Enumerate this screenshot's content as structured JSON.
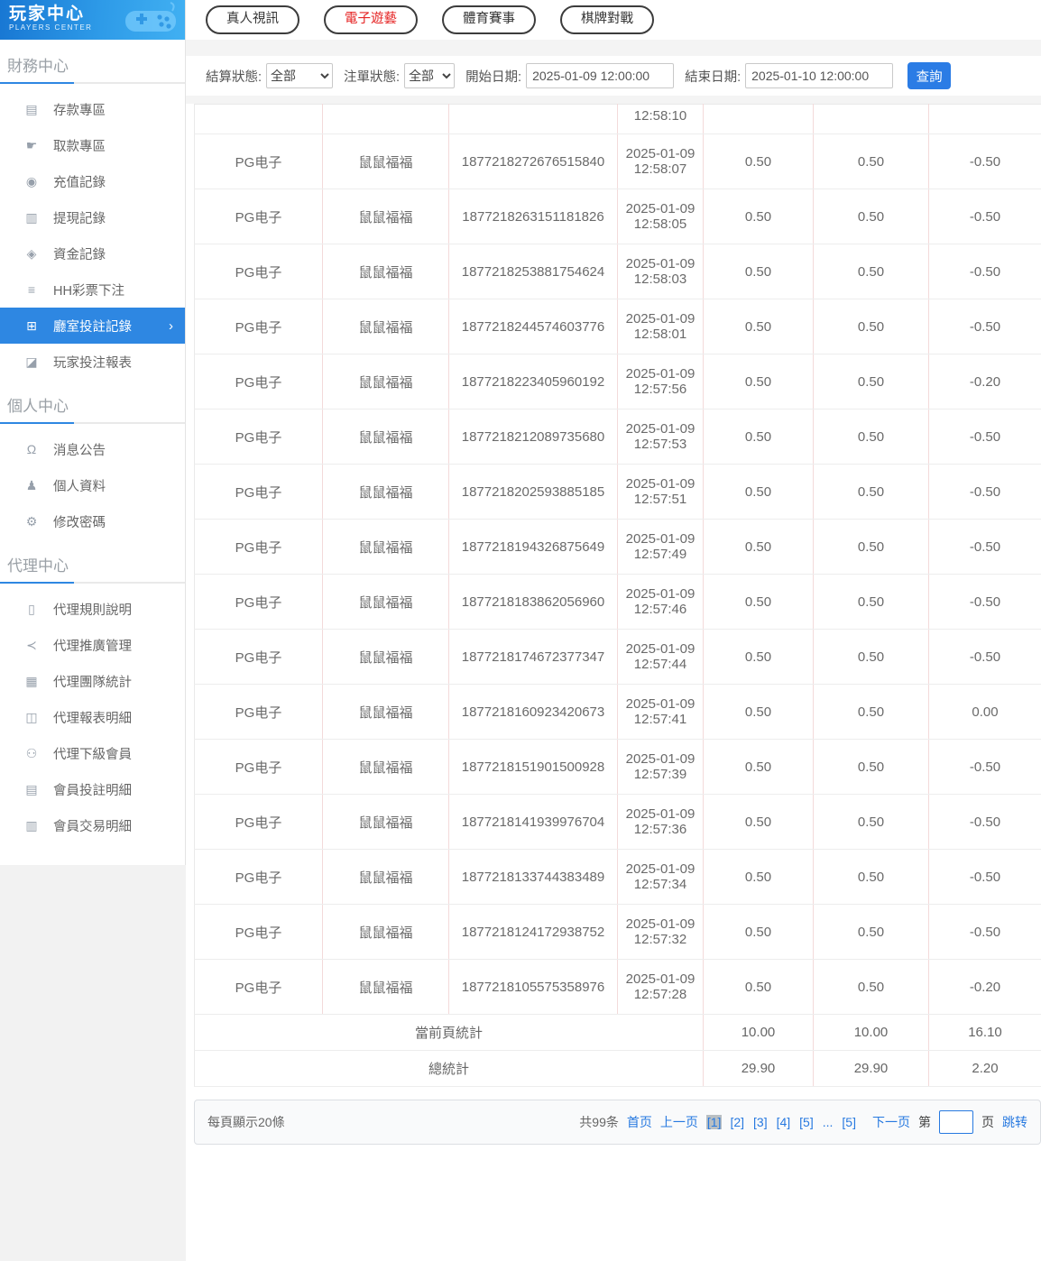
{
  "brand": {
    "title": "玩家中心",
    "subtitle": "PLAYERS CENTER"
  },
  "sidebar": {
    "chevron": "›",
    "sections": [
      {
        "title": "財務中心",
        "items": [
          {
            "label": "存款專區",
            "icon": "deposit-card",
            "glyph": "▤"
          },
          {
            "label": "取款專區",
            "icon": "withdraw-hand",
            "glyph": "☛"
          },
          {
            "label": "充值記錄",
            "icon": "recharge-record",
            "glyph": "◉"
          },
          {
            "label": "提現記錄",
            "icon": "withdrawal-record",
            "glyph": "▥"
          },
          {
            "label": "資金記錄",
            "icon": "funds-record",
            "glyph": "◈"
          },
          {
            "label": "HH彩票下注",
            "icon": "lottery-bet",
            "glyph": "≡"
          },
          {
            "label": "廳室投註記錄",
            "icon": "room-bet-record",
            "glyph": "⊞",
            "active": true
          },
          {
            "label": "玩家投注報表",
            "icon": "player-report",
            "glyph": "◪"
          }
        ]
      },
      {
        "title": "個人中心",
        "items": [
          {
            "label": "消息公告",
            "icon": "message-bell",
            "glyph": "Ω"
          },
          {
            "label": "個人資料",
            "icon": "profile-person",
            "glyph": "♟"
          },
          {
            "label": "修改密碼",
            "icon": "change-password-gear",
            "glyph": "⚙"
          }
        ]
      },
      {
        "title": "代理中心",
        "items": [
          {
            "label": "代理規則說明",
            "icon": "agent-rules-doc",
            "glyph": "▯"
          },
          {
            "label": "代理推廣管理",
            "icon": "agent-promotion-share",
            "glyph": "≺"
          },
          {
            "label": "代理團隊統計",
            "icon": "agent-team-stats",
            "glyph": "▦"
          },
          {
            "label": "代理報表明細",
            "icon": "agent-report-detail",
            "glyph": "◫"
          },
          {
            "label": "代理下級會員",
            "icon": "agent-sub-members",
            "glyph": "⚇"
          },
          {
            "label": "會員投註明細",
            "icon": "member-bet-detail",
            "glyph": "▤"
          },
          {
            "label": "會員交易明細",
            "icon": "member-transaction-detail",
            "glyph": "▥"
          }
        ]
      }
    ]
  },
  "tabs": [
    {
      "label": "真人視訊"
    },
    {
      "label": "電子遊藝",
      "active": true
    },
    {
      "label": "體育賽事"
    },
    {
      "label": "棋牌對戰"
    }
  ],
  "filters": {
    "settle_label": "結算狀態:",
    "settle_value": "全部",
    "order_label": "注單狀態:",
    "order_value": "全部",
    "start_label": "開始日期:",
    "start_value": "2025-01-09 12:00:00",
    "end_label": "結束日期:",
    "end_value": "2025-01-10 12:00:00",
    "search_label": "查詢"
  },
  "table": {
    "partial_time": "12:58:10",
    "rows": [
      {
        "provider": "PG电子",
        "game": "鼠鼠福福",
        "order": "1877218272676515840",
        "date": "2025-01-09",
        "time": "12:58:07",
        "bet": "0.50",
        "valid": "0.50",
        "winloss": "-0.50"
      },
      {
        "provider": "PG电子",
        "game": "鼠鼠福福",
        "order": "1877218263151181826",
        "date": "2025-01-09",
        "time": "12:58:05",
        "bet": "0.50",
        "valid": "0.50",
        "winloss": "-0.50"
      },
      {
        "provider": "PG电子",
        "game": "鼠鼠福福",
        "order": "1877218253881754624",
        "date": "2025-01-09",
        "time": "12:58:03",
        "bet": "0.50",
        "valid": "0.50",
        "winloss": "-0.50"
      },
      {
        "provider": "PG电子",
        "game": "鼠鼠福福",
        "order": "1877218244574603776",
        "date": "2025-01-09",
        "time": "12:58:01",
        "bet": "0.50",
        "valid": "0.50",
        "winloss": "-0.50"
      },
      {
        "provider": "PG电子",
        "game": "鼠鼠福福",
        "order": "1877218223405960192",
        "date": "2025-01-09",
        "time": "12:57:56",
        "bet": "0.50",
        "valid": "0.50",
        "winloss": "-0.20"
      },
      {
        "provider": "PG电子",
        "game": "鼠鼠福福",
        "order": "1877218212089735680",
        "date": "2025-01-09",
        "time": "12:57:53",
        "bet": "0.50",
        "valid": "0.50",
        "winloss": "-0.50"
      },
      {
        "provider": "PG电子",
        "game": "鼠鼠福福",
        "order": "1877218202593885185",
        "date": "2025-01-09",
        "time": "12:57:51",
        "bet": "0.50",
        "valid": "0.50",
        "winloss": "-0.50"
      },
      {
        "provider": "PG电子",
        "game": "鼠鼠福福",
        "order": "1877218194326875649",
        "date": "2025-01-09",
        "time": "12:57:49",
        "bet": "0.50",
        "valid": "0.50",
        "winloss": "-0.50"
      },
      {
        "provider": "PG电子",
        "game": "鼠鼠福福",
        "order": "1877218183862056960",
        "date": "2025-01-09",
        "time": "12:57:46",
        "bet": "0.50",
        "valid": "0.50",
        "winloss": "-0.50"
      },
      {
        "provider": "PG电子",
        "game": "鼠鼠福福",
        "order": "1877218174672377347",
        "date": "2025-01-09",
        "time": "12:57:44",
        "bet": "0.50",
        "valid": "0.50",
        "winloss": "-0.50"
      },
      {
        "provider": "PG电子",
        "game": "鼠鼠福福",
        "order": "1877218160923420673",
        "date": "2025-01-09",
        "time": "12:57:41",
        "bet": "0.50",
        "valid": "0.50",
        "winloss": "0.00"
      },
      {
        "provider": "PG电子",
        "game": "鼠鼠福福",
        "order": "1877218151901500928",
        "date": "2025-01-09",
        "time": "12:57:39",
        "bet": "0.50",
        "valid": "0.50",
        "winloss": "-0.50"
      },
      {
        "provider": "PG电子",
        "game": "鼠鼠福福",
        "order": "1877218141939976704",
        "date": "2025-01-09",
        "time": "12:57:36",
        "bet": "0.50",
        "valid": "0.50",
        "winloss": "-0.50"
      },
      {
        "provider": "PG电子",
        "game": "鼠鼠福福",
        "order": "1877218133744383489",
        "date": "2025-01-09",
        "time": "12:57:34",
        "bet": "0.50",
        "valid": "0.50",
        "winloss": "-0.50"
      },
      {
        "provider": "PG电子",
        "game": "鼠鼠福福",
        "order": "1877218124172938752",
        "date": "2025-01-09",
        "time": "12:57:32",
        "bet": "0.50",
        "valid": "0.50",
        "winloss": "-0.50"
      },
      {
        "provider": "PG电子",
        "game": "鼠鼠福福",
        "order": "1877218105575358976",
        "date": "2025-01-09",
        "time": "12:57:28",
        "bet": "0.50",
        "valid": "0.50",
        "winloss": "-0.20"
      }
    ],
    "summary": [
      {
        "label": "當前頁統計",
        "bet": "10.00",
        "valid": "10.00",
        "winloss": "16.10"
      },
      {
        "label": "總統計",
        "bet": "29.90",
        "valid": "29.90",
        "winloss": "2.20"
      }
    ]
  },
  "pagination": {
    "per_page": "每頁顯示20條",
    "total": "共99条",
    "first": "首页",
    "prev": "上一页",
    "pages": [
      {
        "label": "[1]",
        "current": true
      },
      {
        "label": "[2]"
      },
      {
        "label": "[3]"
      },
      {
        "label": "[4]"
      },
      {
        "label": "[5]"
      },
      {
        "label": "..."
      },
      {
        "label": "[5]"
      }
    ],
    "next": "下一页",
    "jump_prefix": "第",
    "jump_suffix": "页",
    "jump_action": "跳转",
    "jump_value": ""
  },
  "colors": {
    "accent_blue": "#2e87e2",
    "link_blue": "#2779e0",
    "active_red": "#e52222"
  }
}
